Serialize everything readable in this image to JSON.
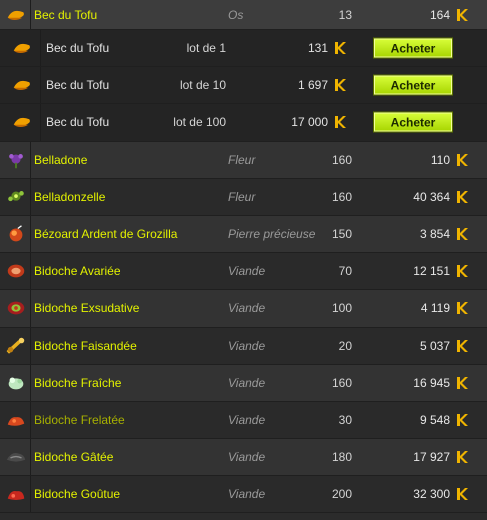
{
  "colors": {
    "accent": "#e3f200",
    "buy_button": "#c5f000",
    "kamas": "#f0b400"
  },
  "header_item": {
    "icon": "tofu-beak-icon",
    "name": "Bec du Tofu",
    "category": "Os",
    "level": "13",
    "price": "164"
  },
  "lots": [
    {
      "name": "Bec du Tofu",
      "lot": "lot de 1",
      "price": "131",
      "buy": "Acheter"
    },
    {
      "name": "Bec du Tofu",
      "lot": "lot de 10",
      "price": "1 697",
      "buy": "Acheter"
    },
    {
      "name": "Bec du Tofu",
      "lot": "lot de 100",
      "price": "17 000",
      "buy": "Acheter"
    }
  ],
  "items": [
    {
      "icon": "belladone-flower-icon",
      "name": "Belladone",
      "category": "Fleur",
      "level": "160",
      "price": "110"
    },
    {
      "icon": "belladonzelle-flower-icon",
      "name": "Belladonzelle",
      "category": "Fleur",
      "level": "160",
      "price": "40 364"
    },
    {
      "icon": "bezoar-stone-icon",
      "name": "Bézoard Ardent de Grozilla",
      "category": "Pierre précieuse",
      "level": "150",
      "price": "3 854"
    },
    {
      "icon": "meat-icon",
      "name": "Bidoche Avariée",
      "category": "Viande",
      "level": "70",
      "price": "12 151"
    },
    {
      "icon": "meat-icon",
      "name": "Bidoche Exsudative",
      "category": "Viande",
      "level": "100",
      "price": "4 119"
    },
    {
      "icon": "meat-icon",
      "name": "Bidoche Faisandée",
      "category": "Viande",
      "level": "20",
      "price": "5 037"
    },
    {
      "icon": "meat-icon",
      "name": "Bidoche Fraîche",
      "category": "Viande",
      "level": "160",
      "price": "16 945"
    },
    {
      "icon": "meat-icon",
      "name": "Bidoche Frelatée",
      "category": "Viande",
      "level": "30",
      "price": "9 548",
      "dim": true
    },
    {
      "icon": "meat-icon",
      "name": "Bidoche Gâtée",
      "category": "Viande",
      "level": "180",
      "price": "17 927"
    },
    {
      "icon": "meat-icon",
      "name": "Bidoche Goûtue",
      "category": "Viande",
      "level": "200",
      "price": "32 300"
    }
  ]
}
